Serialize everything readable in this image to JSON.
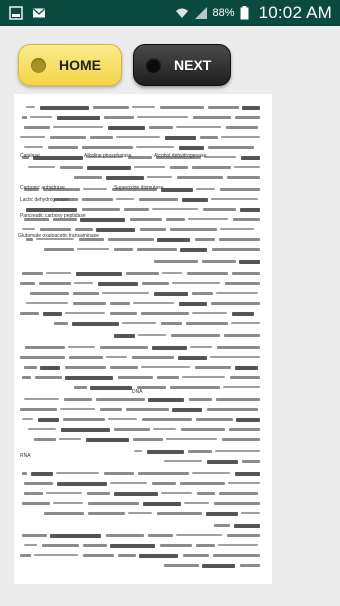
{
  "status_bar": {
    "battery_percent": "88%",
    "time": "10:02 AM",
    "left_icons": [
      "gallery-icon",
      "mail-icon"
    ],
    "right_icons": [
      "wifi-icon",
      "signal-icon",
      "battery-icon"
    ]
  },
  "buttons": {
    "home_label": "HOME",
    "next_label": "NEXT"
  },
  "document": {
    "latin_terms": [
      "Catalase",
      "Alkaline phosphatase",
      "Alcohol dehydrogenase",
      "Carbonic anhydrase",
      "Superoxide dismutase",
      "Lactic dehydrogenase",
      "Pancreatic carboxy peptidase",
      "Glutamate oxaloacetic transaminase",
      "DNA",
      "RNA"
    ]
  },
  "colors": {
    "status_bar": "#0b4a3f",
    "home_button": "#f4d646",
    "next_button": "#1e1e1e",
    "background": "#ececec"
  }
}
